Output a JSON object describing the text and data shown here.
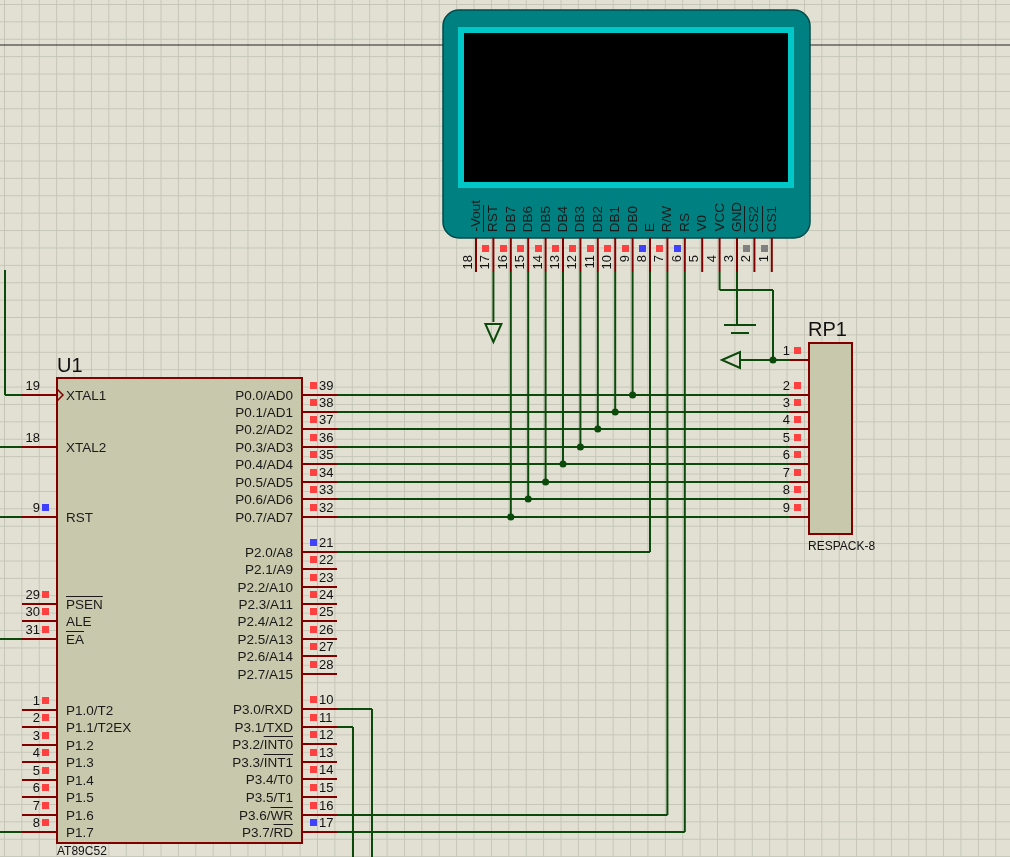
{
  "lcd": {
    "pins": [
      {
        "num": "18",
        "label": "-Vout"
      },
      {
        "num": "17",
        "overbar": "RST",
        "color": "#ff4040"
      },
      {
        "num": "16",
        "label": "DB7",
        "color": "#ff4040"
      },
      {
        "num": "15",
        "label": "DB6",
        "color": "#ff4040"
      },
      {
        "num": "14",
        "label": "DB5",
        "color": "#ff4040"
      },
      {
        "num": "13",
        "label": "DB4",
        "color": "#ff4040"
      },
      {
        "num": "12",
        "label": "DB3",
        "color": "#ff4040"
      },
      {
        "num": "11",
        "label": "DB2",
        "color": "#ff4040"
      },
      {
        "num": "10",
        "label": "DB1",
        "color": "#ff4040"
      },
      {
        "num": "9",
        "label": "DB0",
        "color": "#ff4040"
      },
      {
        "num": "8",
        "label": "E",
        "color": "#4040ff"
      },
      {
        "num": "7",
        "label": "R/W",
        "color": "#ff4040"
      },
      {
        "num": "6",
        "label": "RS",
        "color": "#4040ff"
      },
      {
        "num": "5",
        "label": "V0"
      },
      {
        "num": "4",
        "label": "VCC"
      },
      {
        "num": "3",
        "label": "GND"
      },
      {
        "num": "2",
        "overbar": "CS2",
        "color": "#808080"
      },
      {
        "num": "1",
        "overbar": "CS1",
        "color": "#808080"
      }
    ]
  },
  "u1": {
    "ref": "U1",
    "part": "AT89C52",
    "left_pins": [
      {
        "num": "19",
        "label": "XTAL1"
      },
      {
        "num": "18",
        "label": "XTAL2"
      },
      {
        "num": "9",
        "label": "RST",
        "color": "#4040ff"
      },
      {
        "num": "29",
        "overbar": "PSEN",
        "color": "#ff4040"
      },
      {
        "num": "30",
        "label": "ALE",
        "color": "#ff4040"
      },
      {
        "num": "31",
        "overbar": "EA",
        "color": "#ff4040"
      },
      {
        "num": "1",
        "label": "P1.0/T2",
        "color": "#ff4040"
      },
      {
        "num": "2",
        "label": "P1.1/T2EX",
        "color": "#ff4040"
      },
      {
        "num": "3",
        "label": "P1.2",
        "color": "#ff4040"
      },
      {
        "num": "4",
        "label": "P1.3",
        "color": "#ff4040"
      },
      {
        "num": "5",
        "label": "P1.4",
        "color": "#ff4040"
      },
      {
        "num": "6",
        "label": "P1.5",
        "color": "#ff4040"
      },
      {
        "num": "7",
        "label": "P1.6",
        "color": "#ff4040"
      },
      {
        "num": "8",
        "label": "P1.7",
        "color": "#ff4040"
      }
    ],
    "right_pins": [
      {
        "num": "39",
        "label": "P0.0/AD0",
        "color": "#ff4040"
      },
      {
        "num": "38",
        "label": "P0.1/AD1",
        "color": "#ff4040"
      },
      {
        "num": "37",
        "label": "P0.2/AD2",
        "color": "#ff4040"
      },
      {
        "num": "36",
        "label": "P0.3/AD3",
        "color": "#ff4040"
      },
      {
        "num": "35",
        "label": "P0.4/AD4",
        "color": "#ff4040"
      },
      {
        "num": "34",
        "label": "P0.5/AD5",
        "color": "#ff4040"
      },
      {
        "num": "33",
        "label": "P0.6/AD6",
        "color": "#ff4040"
      },
      {
        "num": "32",
        "label": "P0.7/AD7",
        "color": "#ff4040"
      },
      {
        "num": "21",
        "label": "P2.0/A8",
        "color": "#4040ff"
      },
      {
        "num": "22",
        "label": "P2.1/A9",
        "color": "#ff4040"
      },
      {
        "num": "23",
        "label": "P2.2/A10",
        "color": "#ff4040"
      },
      {
        "num": "24",
        "label": "P2.3/A11",
        "color": "#ff4040"
      },
      {
        "num": "25",
        "label": "P2.4/A12",
        "color": "#ff4040"
      },
      {
        "num": "26",
        "label": "P2.5/A13",
        "color": "#ff4040"
      },
      {
        "num": "27",
        "label": "P2.6/A14",
        "color": "#ff4040"
      },
      {
        "num": "28",
        "label": "P2.7/A15",
        "color": "#ff4040"
      },
      {
        "num": "10",
        "label": "P3.0/RXD",
        "color": "#ff4040"
      },
      {
        "num": "11",
        "label": "P3.1/TXD",
        "color": "#ff4040"
      },
      {
        "num": "12",
        "label": "P3.2/",
        "overbar": "INT0",
        "color": "#ff4040"
      },
      {
        "num": "13",
        "label": "P3.3/",
        "overbar": "INT1",
        "color": "#ff4040"
      },
      {
        "num": "14",
        "label": "P3.4/T0",
        "color": "#ff4040"
      },
      {
        "num": "15",
        "label": "P3.5/T1",
        "color": "#ff4040"
      },
      {
        "num": "16",
        "label": "P3.6/",
        "overbar": "WR",
        "color": "#ff4040"
      },
      {
        "num": "17",
        "label": "P3.7/",
        "overbar": "RD",
        "color": "#4040ff"
      }
    ]
  },
  "rp1": {
    "ref": "RP1",
    "part": "RESPACK-8",
    "pins": [
      {
        "num": "1",
        "color": "#ff4040"
      },
      {
        "num": "2",
        "color": "#ff4040"
      },
      {
        "num": "3",
        "color": "#ff4040"
      },
      {
        "num": "4",
        "color": "#ff4040"
      },
      {
        "num": "5",
        "color": "#ff4040"
      },
      {
        "num": "6",
        "color": "#ff4040"
      },
      {
        "num": "7",
        "color": "#ff4040"
      },
      {
        "num": "8",
        "color": "#ff4040"
      },
      {
        "num": "9",
        "color": "#ff4040"
      }
    ]
  }
}
